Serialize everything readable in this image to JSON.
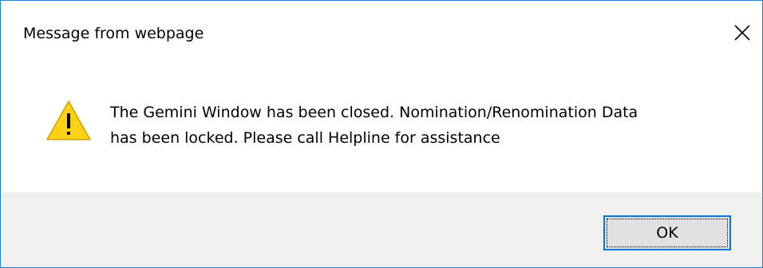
{
  "dialog": {
    "title": "Message from webpage",
    "close_icon": "close-x-icon",
    "message_icon": "warning-icon",
    "message_line1": "The Gemini Window has been closed. Nomination/Renomination Data",
    "message_line2": "has been locked. Please call Helpline for assistance",
    "ok_label": "OK"
  },
  "colors": {
    "window_border": "#1883d7",
    "footer_background": "#f0f0f0",
    "button_background": "#e1e1e1",
    "button_border": "#0078d7",
    "warning_fill": "#fcd116",
    "warning_mark": "#000000"
  }
}
